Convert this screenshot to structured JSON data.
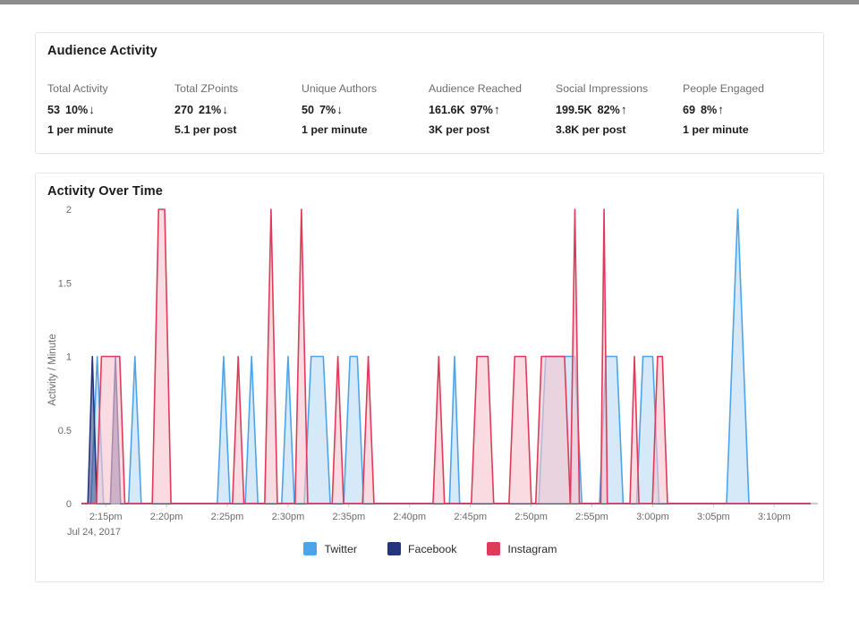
{
  "summary": {
    "title": "Audience Activity",
    "metrics": [
      {
        "label": "Total Activity",
        "value": "53",
        "delta": "10%",
        "arrow": "↓",
        "direction": "down",
        "sub": "1 per minute"
      },
      {
        "label": "Total ZPoints",
        "value": "270",
        "delta": "21%",
        "arrow": "↓",
        "direction": "down",
        "sub": "5.1 per post"
      },
      {
        "label": "Unique Authors",
        "value": "50",
        "delta": "7%",
        "arrow": "↓",
        "direction": "down",
        "sub": "1 per minute"
      },
      {
        "label": "Audience Reached",
        "value": "161.6K",
        "delta": "97%",
        "arrow": "↑",
        "direction": "up",
        "sub": "3K per post"
      },
      {
        "label": "Social Impressions",
        "value": "199.5K",
        "delta": "82%",
        "arrow": "↑",
        "direction": "up",
        "sub": "3.8K per post"
      },
      {
        "label": "People Engaged",
        "value": "69",
        "delta": "8%",
        "arrow": "↑",
        "direction": "up",
        "sub": "1 per minute"
      }
    ]
  },
  "chart_card": {
    "title": "Activity Over Time",
    "date_label": "Jul 24, 2017"
  },
  "legend": {
    "items": [
      {
        "label": "Twitter",
        "color": "#4da4ea"
      },
      {
        "label": "Facebook",
        "color": "#22357e"
      },
      {
        "label": "Instagram",
        "color": "#e03a5a"
      }
    ]
  },
  "chart_data": {
    "type": "area",
    "title": "Activity Over Time",
    "xlabel": "",
    "ylabel": "Activity / Minute",
    "ylim": [
      0,
      2
    ],
    "yticks": [
      0,
      0.5,
      1,
      1.5,
      2
    ],
    "ytick_labels": [
      "0",
      "0.5",
      "1",
      "1.5",
      "2"
    ],
    "grid": false,
    "legend_position": "bottom-center",
    "date_label": "Jul 24, 2017",
    "x_axis_unit": "minutes",
    "x_start": "2:13pm",
    "x_end": "3:13pm",
    "xticks": [
      2,
      7,
      12,
      17,
      22,
      27,
      32,
      37,
      42,
      47,
      52,
      57
    ],
    "xtick_labels": [
      "2:15pm",
      "2:20pm",
      "2:25pm",
      "2:30pm",
      "2:35pm",
      "2:40pm",
      "2:45pm",
      "2:50pm",
      "2:55pm",
      "3:00pm",
      "3:05pm",
      "3:10pm"
    ],
    "series": [
      {
        "name": "Twitter",
        "color": "#4da4ea",
        "fill": "#bcdcf4",
        "peaks": [
          {
            "x": 1.3,
            "y": 1,
            "w": 1.0,
            "flat": 0.0
          },
          {
            "x": 4.4,
            "y": 1,
            "w": 1.0,
            "flat": 0.0
          },
          {
            "x": 11.7,
            "y": 1,
            "w": 1.0,
            "flat": 0.0
          },
          {
            "x": 14.0,
            "y": 1,
            "w": 1.0,
            "flat": 0.0
          },
          {
            "x": 17.0,
            "y": 1,
            "w": 1.0,
            "flat": 0.0
          },
          {
            "x": 19.4,
            "y": 1,
            "w": 1.1,
            "flat": 1.0
          },
          {
            "x": 22.4,
            "y": 1,
            "w": 1.0,
            "flat": 0.6
          },
          {
            "x": 30.7,
            "y": 1,
            "w": 0.8,
            "flat": 0.0
          },
          {
            "x": 39.4,
            "y": 1,
            "w": 1.1,
            "flat": 2.4
          },
          {
            "x": 43.6,
            "y": 1,
            "w": 1.0,
            "flat": 0.9
          },
          {
            "x": 46.6,
            "y": 1,
            "w": 1.0,
            "flat": 0.8
          },
          {
            "x": 54.0,
            "y": 2,
            "w": 1.8,
            "flat": 0.0
          }
        ]
      },
      {
        "name": "Facebook",
        "color": "#22357e",
        "fill": "#4a4f8c",
        "peaks": [
          {
            "x": 0.9,
            "y": 1,
            "w": 0.7,
            "flat": 0.0
          },
          {
            "x": 2.8,
            "y": 1,
            "w": 0.8,
            "flat": 0.0
          }
        ]
      },
      {
        "name": "Instagram",
        "color": "#e03a5a",
        "fill": "#f6c5ce",
        "peaks": [
          {
            "x": 2.4,
            "y": 1,
            "w": 0.8,
            "flat": 1.5
          },
          {
            "x": 6.6,
            "y": 2,
            "w": 1.0,
            "flat": 0.5
          },
          {
            "x": 12.9,
            "y": 1,
            "w": 0.9,
            "flat": 0.0
          },
          {
            "x": 15.6,
            "y": 2,
            "w": 1.0,
            "flat": 0.0
          },
          {
            "x": 18.1,
            "y": 2,
            "w": 1.0,
            "flat": 0.0
          },
          {
            "x": 21.1,
            "y": 1,
            "w": 0.9,
            "flat": 0.0
          },
          {
            "x": 23.6,
            "y": 1,
            "w": 0.9,
            "flat": 0.0
          },
          {
            "x": 29.4,
            "y": 1,
            "w": 0.9,
            "flat": 0.0
          },
          {
            "x": 33.0,
            "y": 1,
            "w": 0.9,
            "flat": 0.9
          },
          {
            "x": 36.1,
            "y": 1,
            "w": 0.9,
            "flat": 0.9
          },
          {
            "x": 38.8,
            "y": 1,
            "w": 0.9,
            "flat": 1.9
          },
          {
            "x": 40.6,
            "y": 2,
            "w": 0.7,
            "flat": 0.0
          },
          {
            "x": 43.0,
            "y": 2,
            "w": 0.5,
            "flat": 0.0
          },
          {
            "x": 45.5,
            "y": 1,
            "w": 0.7,
            "flat": 0.0
          },
          {
            "x": 47.6,
            "y": 1,
            "w": 0.8,
            "flat": 0.4
          }
        ]
      }
    ]
  }
}
